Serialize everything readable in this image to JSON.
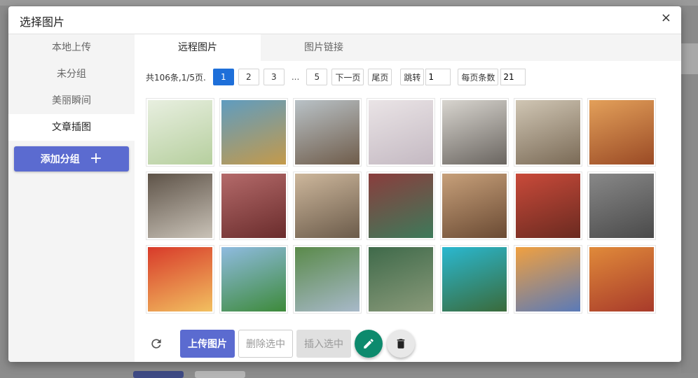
{
  "dialog": {
    "title": "选择图片",
    "close_glyph": "×"
  },
  "sidebar": {
    "items": [
      {
        "label": "本地上传",
        "active": false
      },
      {
        "label": "未分组",
        "active": false
      },
      {
        "label": "美丽瞬间",
        "active": false
      },
      {
        "label": "文章插图",
        "active": true
      }
    ],
    "add_group_label": "添加分组",
    "add_group_icon": "+"
  },
  "tabs": [
    {
      "label": "远程图片",
      "active": true
    },
    {
      "label": "图片链接",
      "active": false
    }
  ],
  "pager": {
    "info": "共106条,1/5页.",
    "pages": [
      "1",
      "2",
      "3"
    ],
    "current": "1",
    "dots": "...",
    "last": "5",
    "next_label": "下一页",
    "end_label": "尾页",
    "jump_label": "跳转",
    "jump_value": "1",
    "per_page_label": "每页条数",
    "per_page_value": "21"
  },
  "images": [
    {
      "name": "anime-girl-garden",
      "c1": "#e8efe0",
      "c2": "#b6cf9e"
    },
    {
      "name": "cartoon-classroom",
      "c1": "#5f9cc0",
      "c2": "#c49a4a"
    },
    {
      "name": "books-sleeping",
      "c1": "#b9c2c7",
      "c2": "#6f5c4a"
    },
    {
      "name": "couple-sketch",
      "c1": "#eae4e6",
      "c2": "#c4b9c2"
    },
    {
      "name": "calligraphy-wall",
      "c1": "#d8d5cf",
      "c2": "#6a6560"
    },
    {
      "name": "banquet-table",
      "c1": "#d0c6b4",
      "c2": "#7a6a56"
    },
    {
      "name": "smiling-elders",
      "c1": "#e3a05a",
      "c2": "#9a4a25"
    },
    {
      "name": "men-at-table",
      "c1": "#5e5348",
      "c2": "#c9c2b7"
    },
    {
      "name": "group-on-stage",
      "c1": "#b46a6a",
      "c2": "#6a2c2c"
    },
    {
      "name": "family-portrait",
      "c1": "#cdb79c",
      "c2": "#6b5b4a"
    },
    {
      "name": "round-table-feast",
      "c1": "#8a3d3d",
      "c2": "#3d7a5a"
    },
    {
      "name": "dinner-gathering",
      "c1": "#c7a07a",
      "c2": "#6a4a33"
    },
    {
      "name": "red-hall-group",
      "c1": "#c94a3a",
      "c2": "#6a2a20"
    },
    {
      "name": "selfie-crowd",
      "c1": "#888888",
      "c2": "#4a4a4a"
    },
    {
      "name": "national-day-poster",
      "c1": "#d83a2a",
      "c2": "#f2c060"
    },
    {
      "name": "grassland-lake",
      "c1": "#8fbbe0",
      "c2": "#3d8a3a"
    },
    {
      "name": "stone-bridge",
      "c1": "#5a8a4a",
      "c2": "#a8b9c9"
    },
    {
      "name": "great-wall",
      "c1": "#3f6a4a",
      "c2": "#8a9a7a"
    },
    {
      "name": "turquoise-lake",
      "c1": "#2ab8d0",
      "c2": "#3a6a3a"
    },
    {
      "name": "sunset-clouds",
      "c1": "#f0a040",
      "c2": "#5a7ab8"
    },
    {
      "name": "waterfall-sunset",
      "c1": "#e08a3a",
      "c2": "#a83a2a"
    }
  ],
  "actions": {
    "upload_label": "上传图片",
    "delete_label": "删除选中",
    "insert_label": "插入选中"
  },
  "colors": {
    "primary": "#5b6bd0",
    "page_active": "#1e6fd9",
    "edit_fab": "#0d8a6d"
  }
}
